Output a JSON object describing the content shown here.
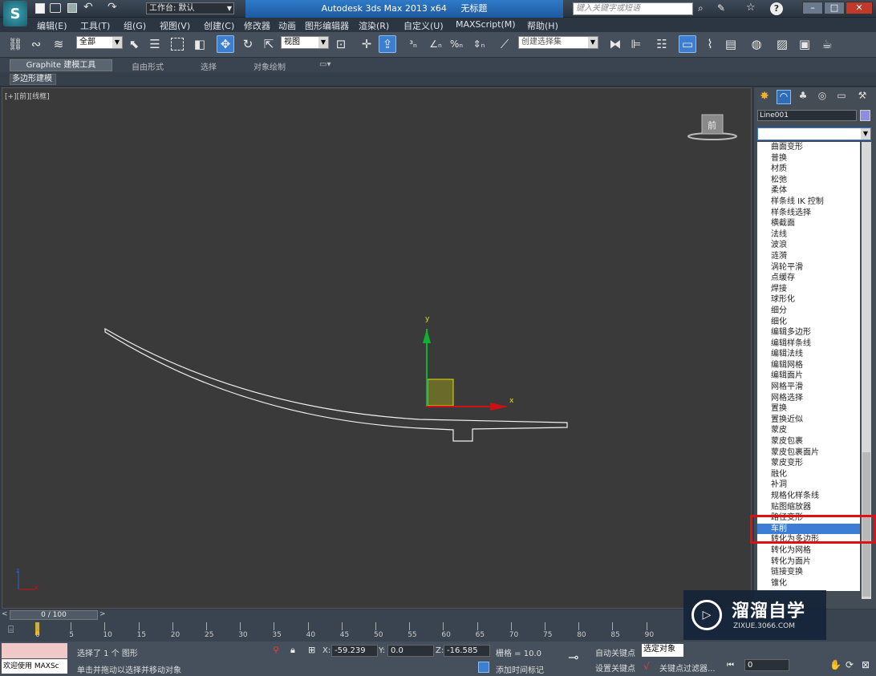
{
  "titlebar": {
    "app_title": "Autodesk 3ds Max  2013 x64",
    "doc_title": "无标题",
    "workspace_label": "工作台: 默认",
    "search_placeholder": "键入关键字或短语"
  },
  "menu": [
    "编辑(E)",
    "工具(T)",
    "组(G)",
    "视图(V)",
    "创建(C)",
    "修改器",
    "动画",
    "图形编辑器",
    "渲染(R)",
    "自定义(U)",
    "MAXScript(M)",
    "帮助(H)"
  ],
  "toolbar": {
    "selection_filter": "全部",
    "ref_coord": "视图",
    "named_selection": "创建选择集",
    "icons": [
      "link-icon",
      "unlink-icon",
      "bind-spacewarp-icon",
      "select-object-icon",
      "select-by-name-icon",
      "rect-select-icon",
      "window-crossing-icon",
      "move-icon",
      "rotate-icon",
      "scale-icon",
      "pivot-icon",
      "select-manipulate-icon",
      "snap-3-icon",
      "angle-snap-icon",
      "percent-snap-icon",
      "spinner-snap-icon",
      "edit-named-sel-icon",
      "mirror-icon",
      "align-icon",
      "layer-icon",
      "ribbon-icon",
      "curve-editor-icon",
      "schematic-icon",
      "material-editor-icon",
      "render-setup-icon",
      "rendered-frame-icon",
      "render-icon"
    ]
  },
  "ribbon": {
    "tabs": [
      "Graphite 建模工具",
      "自由形式",
      "选择",
      "对象绘制"
    ],
    "sub_label": "多边形建模"
  },
  "viewport": {
    "label": "[+][前][线框]",
    "viewcube_label": "前",
    "gizmo_x": "x",
    "gizmo_y": "y",
    "axis_tripod_x": "x",
    "axis_tripod_z": "z"
  },
  "command_panel": {
    "object_name": "Line001",
    "tab_icons": [
      "create-icon",
      "modify-icon",
      "hierarchy-icon",
      "motion-icon",
      "display-icon",
      "utilities-icon"
    ]
  },
  "modifiers": [
    "曲面变形",
    "普换",
    "材质",
    "松弛",
    "柔体",
    "样条线 IK 控制",
    "样条线选择",
    "横截面",
    "法线",
    "波浪",
    "涟漪",
    "涡轮平滑",
    "点缓存",
    "焊接",
    "球形化",
    "细分",
    "细化",
    "编辑多边形",
    "编辑样条线",
    "编辑法线",
    "编辑网格",
    "编辑面片",
    "网格平滑",
    "网格选择",
    "置换",
    "置换近似",
    "蒙皮",
    "蒙皮包裹",
    "蒙皮包裹面片",
    "蒙皮变形",
    "融化",
    "补洞",
    "规格化样条线",
    "贴图缩放器",
    "路径变形",
    "车削",
    "转化为多边形",
    "转化为网格",
    "转化为面片",
    "链接变换",
    "锥化"
  ],
  "selected_modifier": "车削",
  "timeline": {
    "frame": "0 / 100",
    "ticks": [
      "0",
      "5",
      "10",
      "15",
      "20",
      "25",
      "30",
      "35",
      "40",
      "45",
      "50",
      "55",
      "60",
      "65",
      "70",
      "75",
      "80",
      "85",
      "90"
    ]
  },
  "status": {
    "maxscript_label": "欢迎使用 MAXSc",
    "selection_info": "选择了 1 个 图形",
    "prompt": "单击并拖动以选择并移动对象",
    "x_label": "X:",
    "x_value": "-59.239",
    "y_label": "Y:",
    "y_value": "0.0",
    "z_label": "Z:",
    "z_value": "-16.585",
    "grid": "栅格 = 10.0",
    "auto_key": "自动关键点",
    "set_key": "设置关键点",
    "key_mode": "选定对象",
    "add_time_tag": "添加时间标记",
    "key_filter": "关键点过滤器...",
    "frame_field": "0"
  },
  "watermark": {
    "brand": "溜溜自学",
    "url": "ZIXUE.3066.COM"
  },
  "colors": {
    "accent": "#3d7dd6",
    "highlight_box": "#e01010",
    "gizmo_x": "#d01010",
    "gizmo_y": "#10b030"
  }
}
